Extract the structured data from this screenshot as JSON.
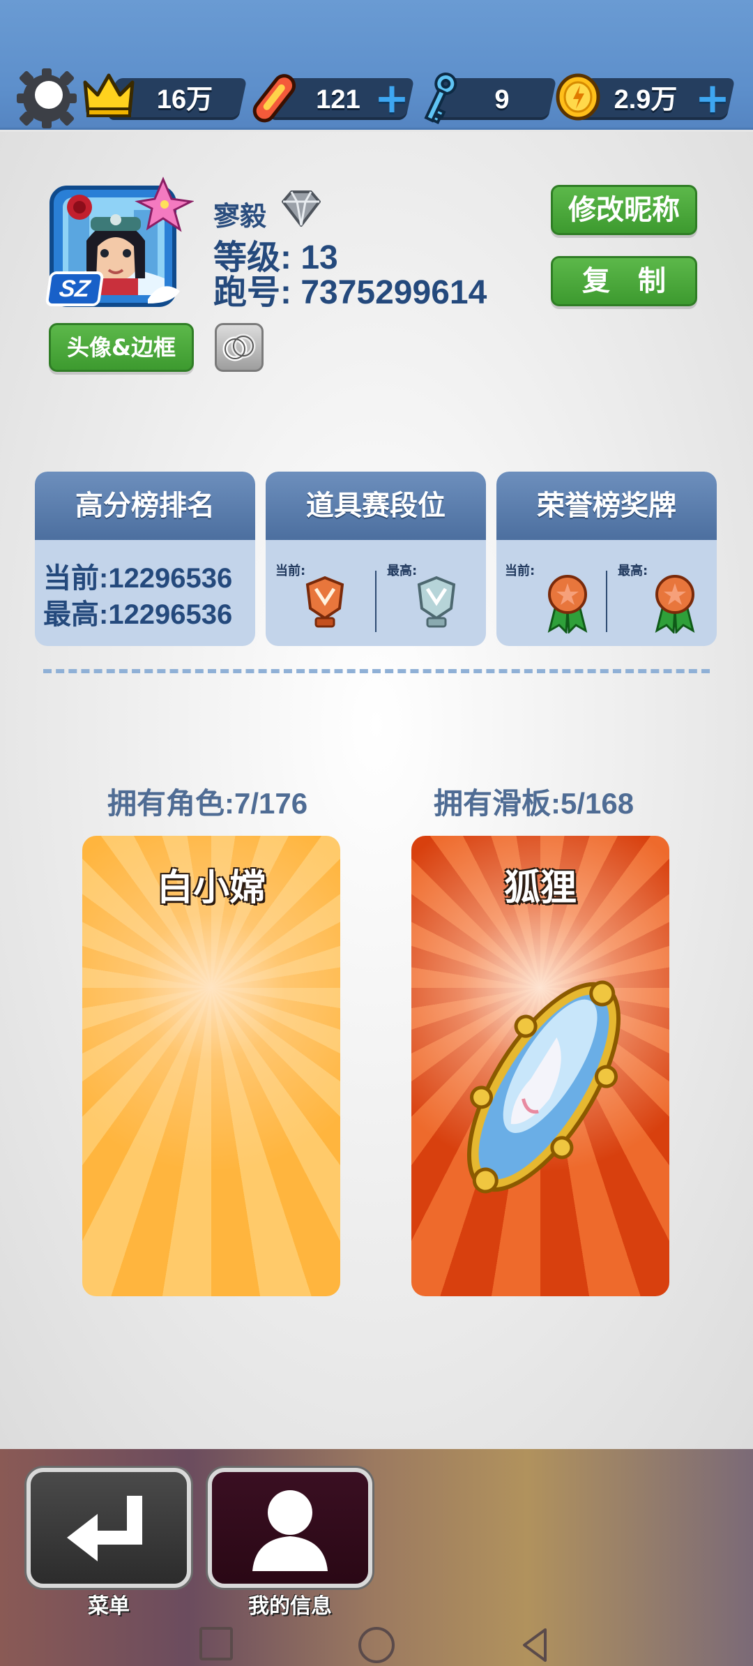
{
  "topbar": {
    "crown_value": "16万",
    "boards_value": "121",
    "keys_value": "9",
    "coins_value": "2.9万",
    "plus_glyph": "+"
  },
  "profile": {
    "name": "寥毅",
    "level_label": "等级: 13",
    "runner_id_label": "跑号: 7375299614",
    "avatar_badge": "SZ",
    "edit_nickname_label": "修改昵称",
    "copy_label": "复　制",
    "avatar_frame_label": "头像&边框"
  },
  "stats": {
    "highscore": {
      "title": "高分榜排名",
      "current": "当前:12296536",
      "best": "最高:12296536"
    },
    "item_tier": {
      "title": "道具赛段位",
      "current_label": "当前:",
      "best_label": "最高:"
    },
    "honor_medal": {
      "title": "荣誉榜奖牌",
      "current_label": "当前:",
      "best_label": "最高:"
    }
  },
  "collection": {
    "characters_owned": "拥有角色:7/176",
    "boards_owned": "拥有滑板:5/168",
    "character_name": "白小嫦",
    "board_name": "狐狸"
  },
  "bottom_nav": {
    "menu_label": "菜单",
    "my_info_label": "我的信息"
  },
  "colors": {
    "top_bar": "#5d8fcb",
    "green_button": "#46a338",
    "card_orange": "#ffb84a",
    "card_red": "#e0501c",
    "stat_header": "#5577a6"
  }
}
